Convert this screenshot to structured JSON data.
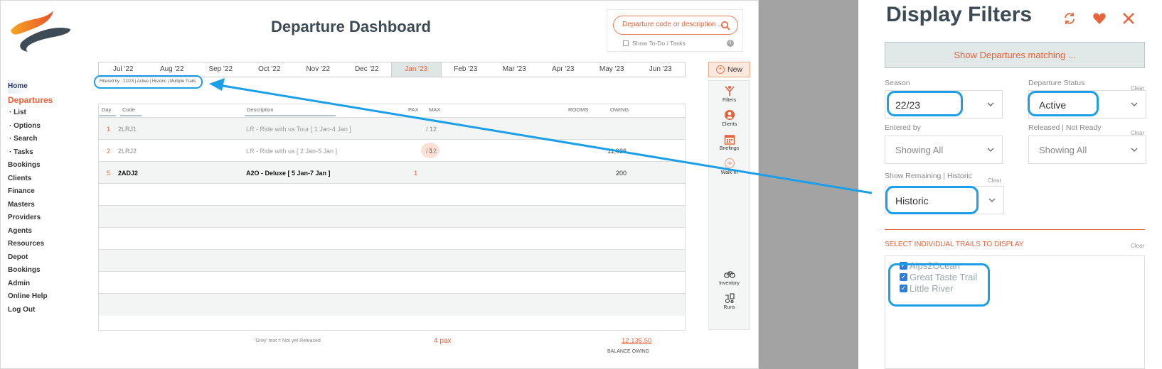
{
  "header": {
    "title": "Departure Dashboard",
    "search_placeholder": "Departure code or description ...",
    "todo_label": "Show To-Do / Tasks",
    "info_glyph": "i"
  },
  "months": [
    "Jul '22",
    "Aug '22",
    "Sep '22",
    "Oct '22",
    "Nov '22",
    "Dec '22",
    "Jan '23",
    "Feb '23",
    "Mar '23",
    "Apr '23",
    "May '23",
    "Jun '23"
  ],
  "active_month": "Jan '23",
  "new_button": {
    "label": "New",
    "glyph": "+"
  },
  "filter_summary": "Filtered by : 22/23 | Active | Historic | Multiple Trails",
  "sidebar": {
    "items": [
      {
        "label": "Home",
        "kind": "home"
      },
      {
        "label": "Departures",
        "kind": "section"
      },
      {
        "label": "List",
        "kind": "sub"
      },
      {
        "label": "Options",
        "kind": "sub"
      },
      {
        "label": "Search",
        "kind": "sub"
      },
      {
        "label": "Tasks",
        "kind": "sub"
      },
      {
        "label": "Bookings",
        "kind": "item"
      },
      {
        "label": "Clients",
        "kind": "item"
      },
      {
        "label": "Finance",
        "kind": "item"
      },
      {
        "label": "Masters",
        "kind": "item"
      },
      {
        "label": "Providers",
        "kind": "item"
      },
      {
        "label": "Agents",
        "kind": "item"
      },
      {
        "label": "Resources",
        "kind": "item"
      },
      {
        "label": "Depot",
        "kind": "item"
      },
      {
        "label": "Bookings",
        "kind": "item"
      },
      {
        "label": "Admin",
        "kind": "item"
      },
      {
        "label": "Online Help",
        "kind": "item"
      },
      {
        "label": "Log Out",
        "kind": "item"
      }
    ]
  },
  "table": {
    "columns": {
      "day": "Day",
      "code": "Code",
      "description": "Description",
      "pax": "PAX",
      "max": "MAX",
      "rooms": "ROOMS",
      "owing": "OWING"
    },
    "rows": [
      {
        "day": "1",
        "code": "2LRJ1",
        "description": "LR - Ride with us Tour  [ 1 Jan-4 Jan ]",
        "pax": "",
        "max": "/ 12",
        "owing": "",
        "style": "grey"
      },
      {
        "day": "2",
        "code": "2LRJ2",
        "description": "LR - Ride with us  [ 2 Jan-5 Jan ]",
        "pax": "3",
        "max": "/ 12",
        "owing": "11,936",
        "style": "grey"
      },
      {
        "day": "5",
        "code": "2ADJ2",
        "description": "A2O - Deluxe  [ 5 Jan-7 Jan ]",
        "pax": "1",
        "max": "",
        "owing": "200",
        "style": "bold"
      }
    ]
  },
  "footer": {
    "note": "'Grey' text = Not yet Released",
    "pax_total": "4 pax",
    "balance": "12,135.50",
    "balance_label": "BALANCE OWING"
  },
  "toolbar": {
    "filters": "Filters",
    "clients": "Clients",
    "briefings": "Briefings",
    "walkin": "Walk-In",
    "inventory": "Inventory",
    "runs": "Runs"
  },
  "panel": {
    "title": "Display Filters",
    "show_button": "Show Departures matching ...",
    "season": {
      "label": "Season",
      "value": "22/23"
    },
    "status": {
      "label": "Departure Status",
      "value": "Active",
      "clear": "Clear"
    },
    "entered_by": {
      "label": "Entered by",
      "value": "Showing All"
    },
    "released": {
      "label": "Released | Not Ready",
      "value": "Showing All",
      "clear": "Clear"
    },
    "remaining": {
      "label": "Show Remaining | Historic",
      "value": "Historic",
      "clear": "Clear"
    },
    "trails": {
      "heading": "SELECT INDIVIDUAL TRAILS TO DISPLAY",
      "clear": "Clear",
      "items": [
        "Alps2Ocean",
        "Great Taste Trail",
        "Little River"
      ]
    }
  },
  "colors": {
    "accent": "#e8623a",
    "highlight": "#1a9fe8",
    "title": "#3d4b56"
  }
}
